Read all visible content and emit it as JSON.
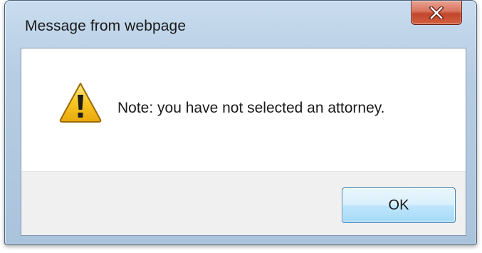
{
  "dialog": {
    "title": "Message from webpage",
    "close_icon": "close-icon",
    "icon": "warning-icon",
    "message": "Note: you have not selected an attorney.",
    "ok_label": "OK"
  },
  "colors": {
    "close_button": "#c9462c",
    "warning_fill": "#f7c623",
    "ok_button_border": "#3c7fb1",
    "footer_background": "#f0f0f0"
  }
}
